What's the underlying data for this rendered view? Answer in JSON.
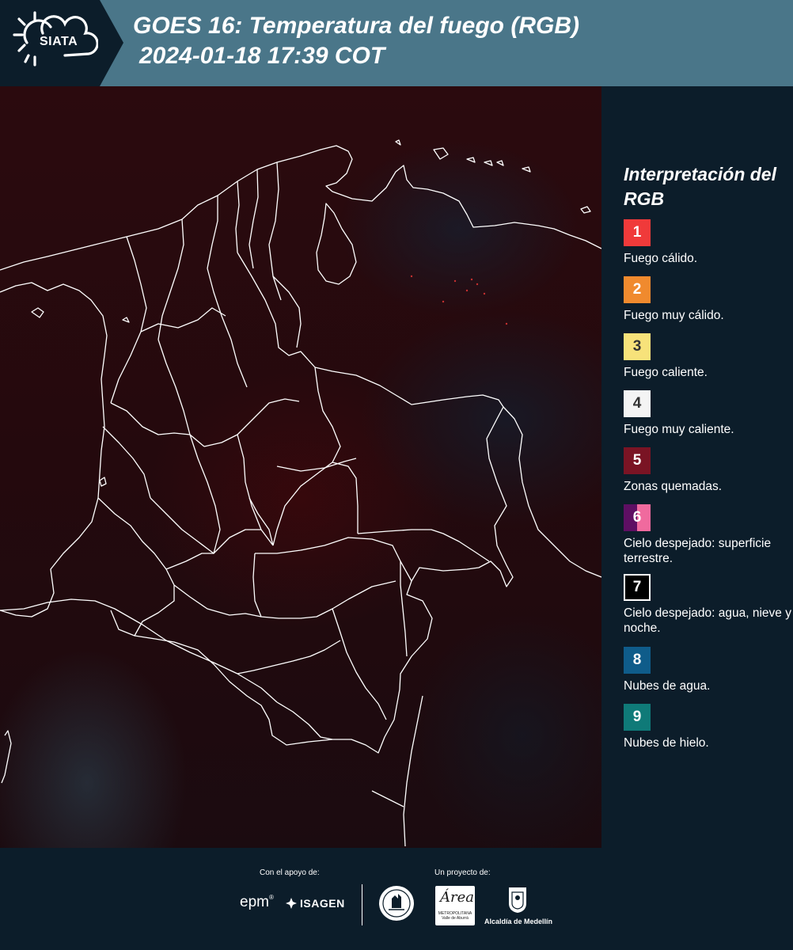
{
  "header": {
    "logo_text": "SIATA",
    "title": "GOES 16: Temperatura del fuego (RGB)",
    "datetime": "2024-01-18 17:39 COT",
    "logo_icon": "sun-cloud-icon"
  },
  "colors": {
    "header_band": "#4a7689",
    "panel_dark": "#0c1d2a",
    "map_base": "#24090d",
    "borders": "#ffffff"
  },
  "legend": {
    "title": "Interpretación del RGB",
    "items": [
      {
        "number": "1",
        "label": "Fuego cálido.",
        "color": "#f03a3a",
        "text_color": "#ffffff"
      },
      {
        "number": "2",
        "label": "Fuego muy cálido.",
        "color": "#f08a2e",
        "text_color": "#ffffff"
      },
      {
        "number": "3",
        "label": "Fuego caliente.",
        "color": "#f7e27a",
        "text_color": "#333333"
      },
      {
        "number": "4",
        "label": "Fuego muy caliente.",
        "color": "#f4f4f4",
        "text_color": "#333333"
      },
      {
        "number": "5",
        "label": "Zonas quemadas.",
        "color": "#7a1424",
        "text_color": "#ffffff"
      },
      {
        "number": "6",
        "label": "Cielo despejado: superficie terrestre.",
        "color": "#5e0f63",
        "color2": "#f06a9e",
        "text_color": "#ffffff"
      },
      {
        "number": "7",
        "label": "Cielo despejado: agua, nieve y noche.",
        "color": "#000000",
        "border": "#ffffff",
        "text_color": "#ffffff"
      },
      {
        "number": "8",
        "label": "Nubes de agua.",
        "color": "#0f5c8a",
        "text_color": "#ffffff"
      },
      {
        "number": "9",
        "label": "Nubes de hielo.",
        "color": "#0f7a78",
        "text_color": "#ffffff"
      }
    ]
  },
  "footer": {
    "support_caption": "Con el apoyo de:",
    "project_caption": "Un proyecto de:",
    "logo_epm": "epm",
    "logo_isagen": "ISAGEN",
    "logo_area_script": "Área",
    "logo_area_text": "METROPOLITANA Valle de Aburrá",
    "logo_alcaldia": "Alcaldía de Medellín"
  }
}
